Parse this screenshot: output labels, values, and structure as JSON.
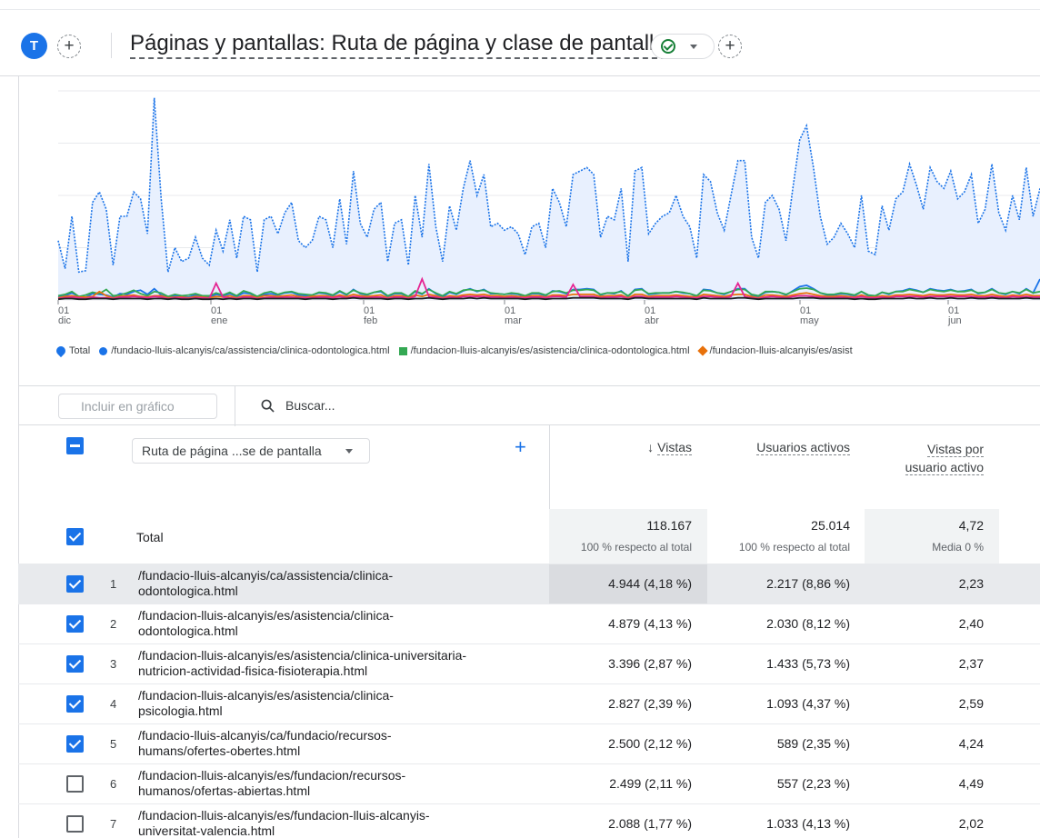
{
  "header": {
    "avatar_letter": "T",
    "add_label": "+",
    "title": "Páginas y pantallas: Ruta de página y clase de pantalla",
    "add_comparison_label": "+"
  },
  "chart_data": {
    "type": "line",
    "x_tick_labels": [
      {
        "day": "01",
        "month": "dic"
      },
      {
        "day": "01",
        "month": "ene"
      },
      {
        "day": "01",
        "month": "feb"
      },
      {
        "day": "01",
        "month": "mar"
      },
      {
        "day": "01",
        "month": "abr"
      },
      {
        "day": "01",
        "month": "may"
      },
      {
        "day": "01",
        "month": "jun"
      }
    ],
    "y_tick_labels": [],
    "grid": true,
    "legend_position": "bottom",
    "colors": {
      "total": "#1a73e8",
      "total_fill": "#e8f0fe",
      "s1": "#1a73e8",
      "s2": "#34a853",
      "s3": "#e8710a",
      "s4": "#e52592",
      "s5": "#202124"
    },
    "series": [
      {
        "name": "Total",
        "values": [
          85,
          45,
          120,
          40,
          42,
          140,
          155,
          130,
          50,
          120,
          120,
          155,
          145,
          95,
          290,
          145,
          40,
          75,
          55,
          60,
          90,
          60,
          50,
          100,
          70,
          115,
          60,
          120,
          115,
          40,
          115,
          120,
          95,
          125,
          140,
          85,
          75,
          85,
          120,
          115,
          75,
          145,
          80,
          185,
          110,
          90,
          130,
          140,
          55,
          110,
          115,
          50,
          150,
          90,
          195,
          105,
          55,
          135,
          100,
          160,
          200,
          150,
          180,
          105,
          110,
          100,
          105,
          95,
          65,
          105,
          110,
          75,
          160,
          140,
          105,
          180,
          185,
          190,
          180,
          90,
          120,
          115,
          160,
          55,
          185,
          190,
          95,
          110,
          120,
          125,
          150,
          120,
          105,
          60,
          180,
          170,
          125,
          100,
          150,
          200,
          200,
          90,
          60,
          140,
          150,
          130,
          85,
          160,
          230,
          250,
          190,
          120,
          80,
          90,
          110,
          95,
          75,
          150,
          70,
          65,
          135,
          100,
          145,
          155,
          195,
          165,
          130,
          190,
          170,
          160,
          185,
          145,
          155,
          180,
          110,
          130,
          195,
          125,
          100,
          150,
          115,
          190,
          120,
          160
        ]
      },
      {
        "name": "/fundacio-lluis-alcanyis/ca/assistencia/clinica-odontologica.html",
        "values": [
          4,
          6,
          10,
          5,
          4,
          9,
          8,
          7,
          4,
          9,
          8,
          12,
          14,
          8,
          16,
          7,
          4,
          6,
          5,
          4,
          7,
          5,
          4,
          8,
          6,
          9,
          5,
          10,
          9,
          3,
          8,
          9,
          7,
          10,
          11,
          7,
          6,
          7,
          10,
          9,
          6,
          12,
          7,
          15,
          9,
          7,
          11,
          12,
          5,
          9,
          9,
          4,
          12,
          8,
          16,
          9,
          4,
          11,
          8,
          13,
          16,
          12,
          15,
          9,
          9,
          8,
          9,
          8,
          5,
          9,
          9,
          6,
          13,
          12,
          9,
          15,
          15,
          16,
          15,
          7,
          10,
          9,
          13,
          5,
          15,
          16,
          8,
          9,
          10,
          10,
          12,
          10,
          9,
          5,
          15,
          14,
          10,
          8,
          12,
          16,
          16,
          7,
          5,
          11,
          12,
          11,
          7,
          13,
          19,
          21,
          16,
          10,
          7,
          7,
          9,
          8,
          6,
          12,
          6,
          5,
          11,
          8,
          12,
          13,
          16,
          14,
          11,
          16,
          14,
          13,
          15,
          12,
          13,
          15,
          9,
          11,
          16,
          10,
          8,
          12,
          9,
          16,
          10,
          30
        ]
      },
      {
        "name": "/fundacion-lluis-alcanyis/es/asistencia/clinica-odontologica.html",
        "values": [
          6,
          8,
          12,
          5,
          7,
          11,
          9,
          15,
          6,
          7,
          10,
          14,
          9,
          6,
          12,
          10,
          5,
          8,
          6,
          7,
          9,
          6,
          6,
          10,
          7,
          11,
          6,
          13,
          10,
          5,
          10,
          12,
          8,
          11,
          12,
          9,
          8,
          7,
          11,
          10,
          7,
          13,
          8,
          14,
          10,
          8,
          11,
          13,
          6,
          10,
          10,
          5,
          13,
          9,
          15,
          10,
          6,
          12,
          9,
          14,
          15,
          13,
          14,
          10,
          9,
          8,
          10,
          9,
          6,
          10,
          10,
          7,
          12,
          13,
          10,
          14,
          14,
          15,
          14,
          8,
          10,
          10,
          12,
          6,
          14,
          15,
          9,
          10,
          10,
          10,
          12,
          11,
          9,
          6,
          14,
          13,
          10,
          9,
          12,
          15,
          15,
          8,
          6,
          12,
          12,
          11,
          8,
          12,
          16,
          17,
          15,
          10,
          8,
          8,
          10,
          9,
          7,
          12,
          7,
          6,
          11,
          9,
          12,
          12,
          15,
          13,
          11,
          15,
          13,
          12,
          14,
          12,
          12,
          14,
          10,
          11,
          15,
          10,
          9,
          12,
          10,
          15,
          10,
          12
        ]
      },
      {
        "name": "/fundacion-lluis-alcanyis/es/asistencia/clinica-universitaria-nutricion-actividad-fisica-fisioterapia.html",
        "values": [
          3,
          5,
          6,
          4,
          4,
          5,
          12,
          6,
          3,
          5,
          6,
          7,
          5,
          4,
          6,
          6,
          3,
          4,
          4,
          3,
          5,
          4,
          3,
          5,
          4,
          6,
          3,
          6,
          6,
          3,
          6,
          6,
          5,
          6,
          7,
          5,
          4,
          5,
          6,
          6,
          4,
          7,
          5,
          8,
          6,
          5,
          6,
          7,
          3,
          6,
          6,
          3,
          7,
          5,
          8,
          6,
          3,
          6,
          5,
          7,
          8,
          7,
          8,
          6,
          6,
          5,
          6,
          5,
          4,
          6,
          6,
          4,
          7,
          7,
          6,
          8,
          8,
          8,
          8,
          5,
          6,
          6,
          7,
          3,
          8,
          8,
          5,
          6,
          6,
          6,
          7,
          6,
          5,
          4,
          8,
          7,
          6,
          5,
          7,
          8,
          8,
          5,
          3,
          7,
          7,
          6,
          5,
          7,
          9,
          10,
          8,
          6,
          5,
          5,
          6,
          5,
          4,
          7,
          4,
          4,
          6,
          5,
          7,
          7,
          8,
          7,
          6,
          8,
          7,
          7,
          8,
          7,
          7,
          8,
          6,
          6,
          8,
          6,
          5,
          7,
          6,
          8,
          6,
          6
        ]
      },
      {
        "name": "/fundacion-lluis-alcanyis/es/asistencia/clinica-psicologia.html",
        "values": [
          2,
          3,
          4,
          3,
          2,
          4,
          3,
          3,
          2,
          4,
          4,
          5,
          4,
          3,
          5,
          4,
          2,
          3,
          3,
          2,
          3,
          3,
          2,
          24,
          4,
          3,
          2,
          4,
          4,
          2,
          3,
          4,
          3,
          4,
          4,
          3,
          3,
          3,
          4,
          4,
          3,
          5,
          3,
          5,
          4,
          3,
          4,
          4,
          2,
          4,
          4,
          2,
          5,
          30,
          5,
          4,
          2,
          4,
          3,
          5,
          5,
          5,
          5,
          4,
          4,
          3,
          4,
          3,
          3,
          4,
          4,
          3,
          5,
          5,
          4,
          22,
          5,
          5,
          5,
          3,
          4,
          4,
          5,
          2,
          5,
          5,
          3,
          4,
          4,
          4,
          5,
          4,
          3,
          3,
          5,
          5,
          4,
          3,
          5,
          24,
          5,
          3,
          2,
          4,
          5,
          4,
          3,
          5,
          6,
          6,
          5,
          4,
          3,
          3,
          4,
          3,
          3,
          5,
          3,
          3,
          4,
          3,
          5,
          5,
          5,
          5,
          4,
          5,
          5,
          5,
          5,
          5,
          5,
          5,
          4,
          4,
          5,
          4,
          3,
          5,
          4,
          5,
          4,
          4
        ]
      },
      {
        "name": "/fundacio-lluis-alcanyis/ca/fundacio/recursos-humans/ofertes-obertes.html",
        "values": [
          1,
          2,
          2,
          1,
          1,
          2,
          2,
          2,
          1,
          2,
          2,
          2,
          2,
          1,
          2,
          2,
          1,
          2,
          1,
          1,
          2,
          1,
          1,
          2,
          1,
          2,
          1,
          2,
          2,
          1,
          2,
          2,
          2,
          2,
          2,
          2,
          1,
          2,
          2,
          2,
          1,
          2,
          2,
          3,
          2,
          2,
          2,
          2,
          1,
          2,
          2,
          1,
          2,
          2,
          3,
          2,
          1,
          2,
          2,
          2,
          3,
          2,
          3,
          2,
          2,
          2,
          2,
          2,
          1,
          2,
          2,
          1,
          2,
          2,
          2,
          3,
          3,
          3,
          3,
          2,
          2,
          2,
          2,
          1,
          3,
          3,
          2,
          2,
          2,
          2,
          2,
          2,
          2,
          1,
          3,
          2,
          2,
          2,
          2,
          3,
          3,
          2,
          1,
          2,
          2,
          2,
          2,
          2,
          3,
          3,
          3,
          2,
          2,
          2,
          2,
          2,
          1,
          2,
          1,
          1,
          2,
          2,
          2,
          2,
          3,
          2,
          2,
          3,
          2,
          2,
          3,
          2,
          2,
          3,
          2,
          2,
          3,
          2,
          2,
          2,
          2,
          3,
          2,
          2
        ]
      }
    ],
    "legend": [
      {
        "name": "Total",
        "shape": "drop",
        "color": "#1a73e8"
      },
      {
        "name": "/fundacio-lluis-alcanyis/ca/assistencia/clinica-odontologica.html",
        "shape": "circle",
        "color": "#1a73e8"
      },
      {
        "name": "/fundacion-lluis-alcanyis/es/asistencia/clinica-odontologica.html",
        "shape": "square",
        "color": "#34a853"
      },
      {
        "name": "/fundacion-lluis-alcanyis/es/asist",
        "shape": "diamond",
        "color": "#e8710a"
      }
    ]
  },
  "toolbar": {
    "include_label": "Incluir en gráfico",
    "search_placeholder": "Buscar..."
  },
  "columns": {
    "dimension": "Ruta de página ...se de pantalla",
    "add_dimension": "+",
    "views": "Vistas",
    "users": "Usuarios activos",
    "views_per_user_line1": "Vistas por",
    "views_per_user_line2": "usuario activo"
  },
  "totals": {
    "label": "Total",
    "views": "118.167",
    "views_sub": "100 % respecto al total",
    "users": "25.014",
    "users_sub": "100 % respecto al total",
    "vpu": "4,72",
    "vpu_sub": "Media 0 %"
  },
  "rows": [
    {
      "idx": "1",
      "checked": true,
      "path1": "/fundacio-lluis-alcanyis/ca/assistencia/clinica-",
      "path2": "odontologica.html",
      "views": "4.944 (4,18 %)",
      "users": "2.217 (8,86 %)",
      "vpu": "2,23"
    },
    {
      "idx": "2",
      "checked": true,
      "path1": "/fundacion-lluis-alcanyis/es/asistencia/clinica-",
      "path2": "odontologica.html",
      "views": "4.879 (4,13 %)",
      "users": "2.030 (8,12 %)",
      "vpu": "2,40"
    },
    {
      "idx": "3",
      "checked": true,
      "path1": "/fundacion-lluis-alcanyis/es/asistencia/clinica-universitaria-",
      "path2": "nutricion-actividad-fisica-fisioterapia.html",
      "views": "3.396 (2,87 %)",
      "users": "1.433 (5,73 %)",
      "vpu": "2,37"
    },
    {
      "idx": "4",
      "checked": true,
      "path1": "/fundacion-lluis-alcanyis/es/asistencia/clinica-",
      "path2": "psicologia.html",
      "views": "2.827 (2,39 %)",
      "users": "1.093 (4,37 %)",
      "vpu": "2,59"
    },
    {
      "idx": "5",
      "checked": true,
      "path1": "/fundacio-lluis-alcanyis/ca/fundacio/recursos-",
      "path2": "humans/ofertes-obertes.html",
      "views": "2.500 (2,12 %)",
      "users": "589 (2,35 %)",
      "vpu": "4,24"
    },
    {
      "idx": "6",
      "checked": false,
      "path1": "/fundacion-lluis-alcanyis/es/fundacion/recursos-",
      "path2": "humanos/ofertas-abiertas.html",
      "views": "2.499 (2,11 %)",
      "users": "557 (2,23 %)",
      "vpu": "4,49"
    },
    {
      "idx": "7",
      "checked": false,
      "path1": "/fundacion-lluis-alcanyis/es/fundacion-lluis-alcanyis-",
      "path2": "universitat-valencia.html",
      "views": "2.088 (1,77 %)",
      "users": "1.033 (4,13 %)",
      "vpu": "2,02"
    }
  ]
}
